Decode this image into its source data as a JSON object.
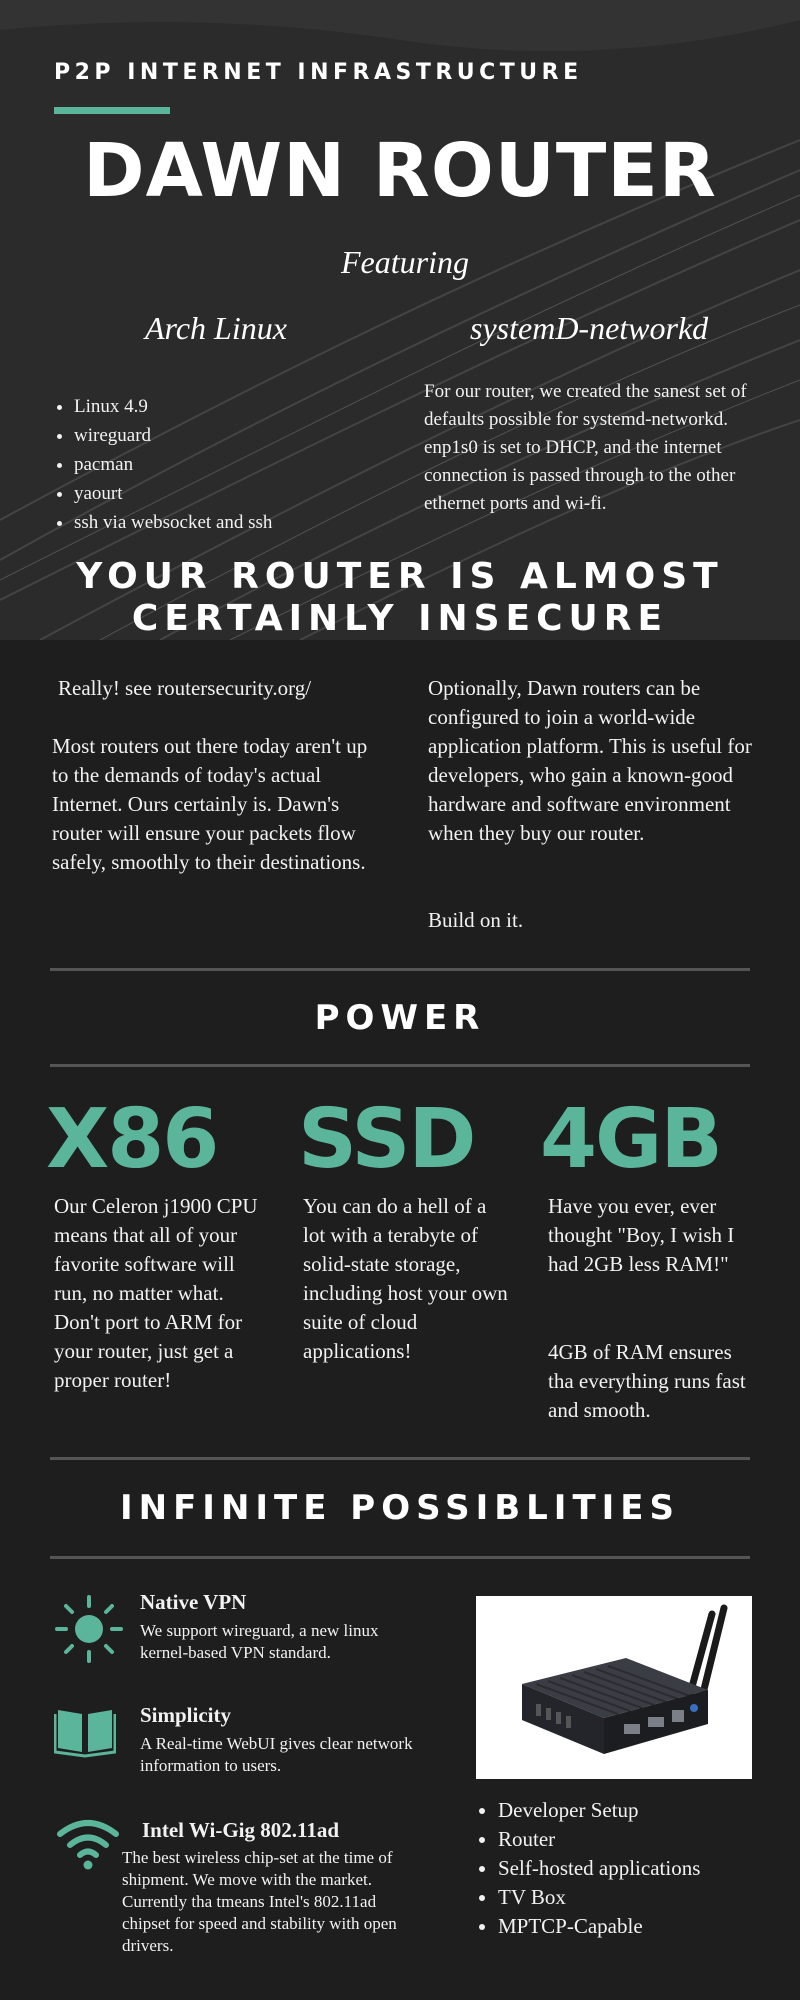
{
  "hero": {
    "kicker": "P2P INTERNET INFRASTRUCTURE",
    "title": "DAWN ROUTER",
    "featuring": "Featuring",
    "left_heading": "Arch Linux",
    "right_heading": "systemD-networkd",
    "left_list": [
      "Linux 4.9",
      "wireguard",
      "pacman",
      "yaourt",
      "ssh via websocket and ssh"
    ],
    "right_text": "For our router, we created the sanest set of defaults possible for systemd-networkd.  enp1s0 is set to DHCP, and the internet connection is passed through to the other ethernet ports and wi-fi."
  },
  "insecure": {
    "headline_line1": "YOUR ROUTER IS ALMOST",
    "headline_line2": "CERTAINLY INSECURE",
    "left_p1": "Really!  see routersecurity.org/",
    "left_p2": "Most routers out there today aren't up to the demands of today's actual Internet.  Ours certainly is.  Dawn's router will ensure your packets flow safely, smoothly to their destinations.",
    "right_p1": "Optionally, Dawn routers can be configured to join a world-wide application platform.  This is useful for developers, who gain a known-good hardware and software environment when they buy our router.",
    "right_p2": "Build on it."
  },
  "power": {
    "heading": "POWER",
    "stats": [
      {
        "value": "X86",
        "text": "Our Celeron j1900 CPU means that all of your favorite software will run, no matter what.  Don't port to ARM for your router, just get a proper router!"
      },
      {
        "value": "SSD",
        "text": "You can do a hell of a lot with a terabyte of solid-state storage, including host your own suite of cloud applications!"
      },
      {
        "value": "4GB",
        "text": "Have you ever, ever thought \"Boy, I wish I had 2GB less RAM!\"",
        "text2": "4GB of RAM ensures tha everything runs fast and smooth."
      }
    ]
  },
  "possibilities": {
    "heading": "INFINITE POSSIBLITIES",
    "features": [
      {
        "icon": "sun-icon",
        "title": "Native VPN",
        "text": "We support wireguard, a new linux kernel-based VPN standard."
      },
      {
        "icon": "book-icon",
        "title": "Simplicity",
        "text": "A Real-time WebUI gives clear network information to users."
      },
      {
        "icon": "wifi-icon",
        "title": "Intel Wi-Gig 802.11ad",
        "text": "The best wireless chip-set at the time of shipment.  We move with the market.  Currently tha tmeans Intel's 802.11ad chipset for speed and stability with open drivers."
      }
    ],
    "uses": [
      "Developer Setup",
      "Router",
      "Self-hosted applications",
      "TV Box",
      "MPTCP-Capable"
    ]
  },
  "colors": {
    "accent": "#5bb59a",
    "background": "#1e1e1e",
    "hero_bg": "#2a2a2a"
  }
}
